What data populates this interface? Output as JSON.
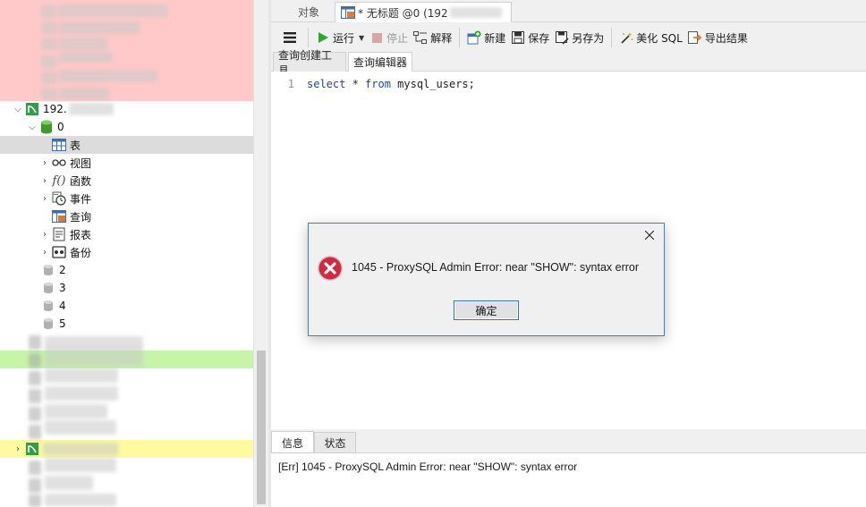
{
  "colors": {
    "top_zone": "#ffc9c9",
    "green_zone": "#c6f5a8",
    "yellow_zone": "#fdfaa0",
    "selection": "#dcdcdc",
    "keyword": "#1a3fd6",
    "dialog_border": "#3a7fd0",
    "error_red": "#d7263d",
    "run_green": "#2aa82a"
  },
  "nav": {
    "connection_label": "192.",
    "database_label": "0",
    "items": [
      {
        "label": "表",
        "icon": "table-icon",
        "selected": true,
        "expandable": false
      },
      {
        "label": "视图",
        "icon": "glasses-view-icon",
        "selected": false,
        "expandable": true
      },
      {
        "label": "函数",
        "icon": "function-icon",
        "selected": false,
        "expandable": true
      },
      {
        "label": "事件",
        "icon": "event-clock-icon",
        "selected": false,
        "expandable": true
      },
      {
        "label": "查询",
        "icon": "query-icon",
        "selected": false,
        "expandable": false
      },
      {
        "label": "报表",
        "icon": "report-icon",
        "selected": false,
        "expandable": true
      },
      {
        "label": "备份",
        "icon": "backup-icon",
        "selected": false,
        "expandable": true
      }
    ],
    "databases": [
      "2",
      "3",
      "4",
      "5"
    ]
  },
  "tabs": {
    "objects": "对象",
    "query": "* 无标题 @0 (192"
  },
  "toolbar": {
    "run": "运行",
    "stop": "停止",
    "explain": "解释",
    "new": "新建",
    "save": "保存",
    "save_as": "另存为",
    "beautify": "美化 SQL",
    "export": "导出结果"
  },
  "subtabs": {
    "builder": "查询创建工具",
    "editor": "查询编辑器"
  },
  "editor": {
    "line_number": "1",
    "kw1": "select",
    "mid": " * ",
    "kw2": "from",
    "rest": " mysql_users;"
  },
  "bottom": {
    "info_tab": "信息",
    "status_tab": "状态",
    "message": "[Err] 1045 - ProxySQL Admin Error: near \"SHOW\": syntax error"
  },
  "dialog": {
    "message": "1045 - ProxySQL Admin Error: near \"SHOW\": syntax error",
    "ok": "确定"
  }
}
